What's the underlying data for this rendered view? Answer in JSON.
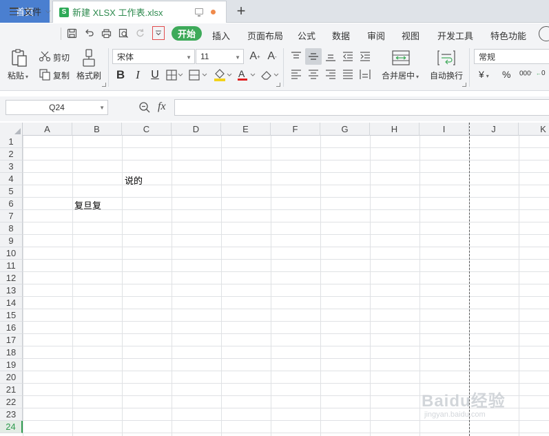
{
  "tabs": {
    "home": "首页",
    "file_badge": "S",
    "file_name": "新建 XLSX 工作表.xlsx",
    "add": "+"
  },
  "menu": {
    "file": "文件",
    "items": [
      "开始",
      "插入",
      "页面布局",
      "公式",
      "数据",
      "审阅",
      "视图",
      "开发工具",
      "特色功能"
    ]
  },
  "ribbon": {
    "paste": "粘贴",
    "cut": "剪切",
    "copy": "复制",
    "format_painter": "格式刷",
    "font_name": "宋体",
    "font_size": "11",
    "merge_center": "合并居中",
    "wrap_text": "自动换行",
    "number_format": "常规",
    "currency": "¥",
    "percent": "%",
    "thousands": "000"
  },
  "formula_bar": {
    "name_box": "Q24",
    "fx": "fx",
    "formula": ""
  },
  "sheet": {
    "columns": [
      "A",
      "B",
      "C",
      "D",
      "E",
      "F",
      "G",
      "H",
      "I",
      "J",
      "K"
    ],
    "rows": [
      "1",
      "2",
      "3",
      "4",
      "5",
      "6",
      "7",
      "8",
      "9",
      "10",
      "11",
      "12",
      "13",
      "14",
      "15",
      "16",
      "17",
      "18",
      "19",
      "20",
      "21",
      "22",
      "23",
      "24"
    ],
    "active_row": "24",
    "cells": {
      "C4": "说的",
      "B6": "复旦复"
    }
  },
  "watermark": {
    "main": "Baidu经验",
    "sub": "jingyan.baidu.com"
  },
  "colors": {
    "accent_green": "#3eaa5a",
    "home_tab_blue": "#4a7fd0"
  }
}
